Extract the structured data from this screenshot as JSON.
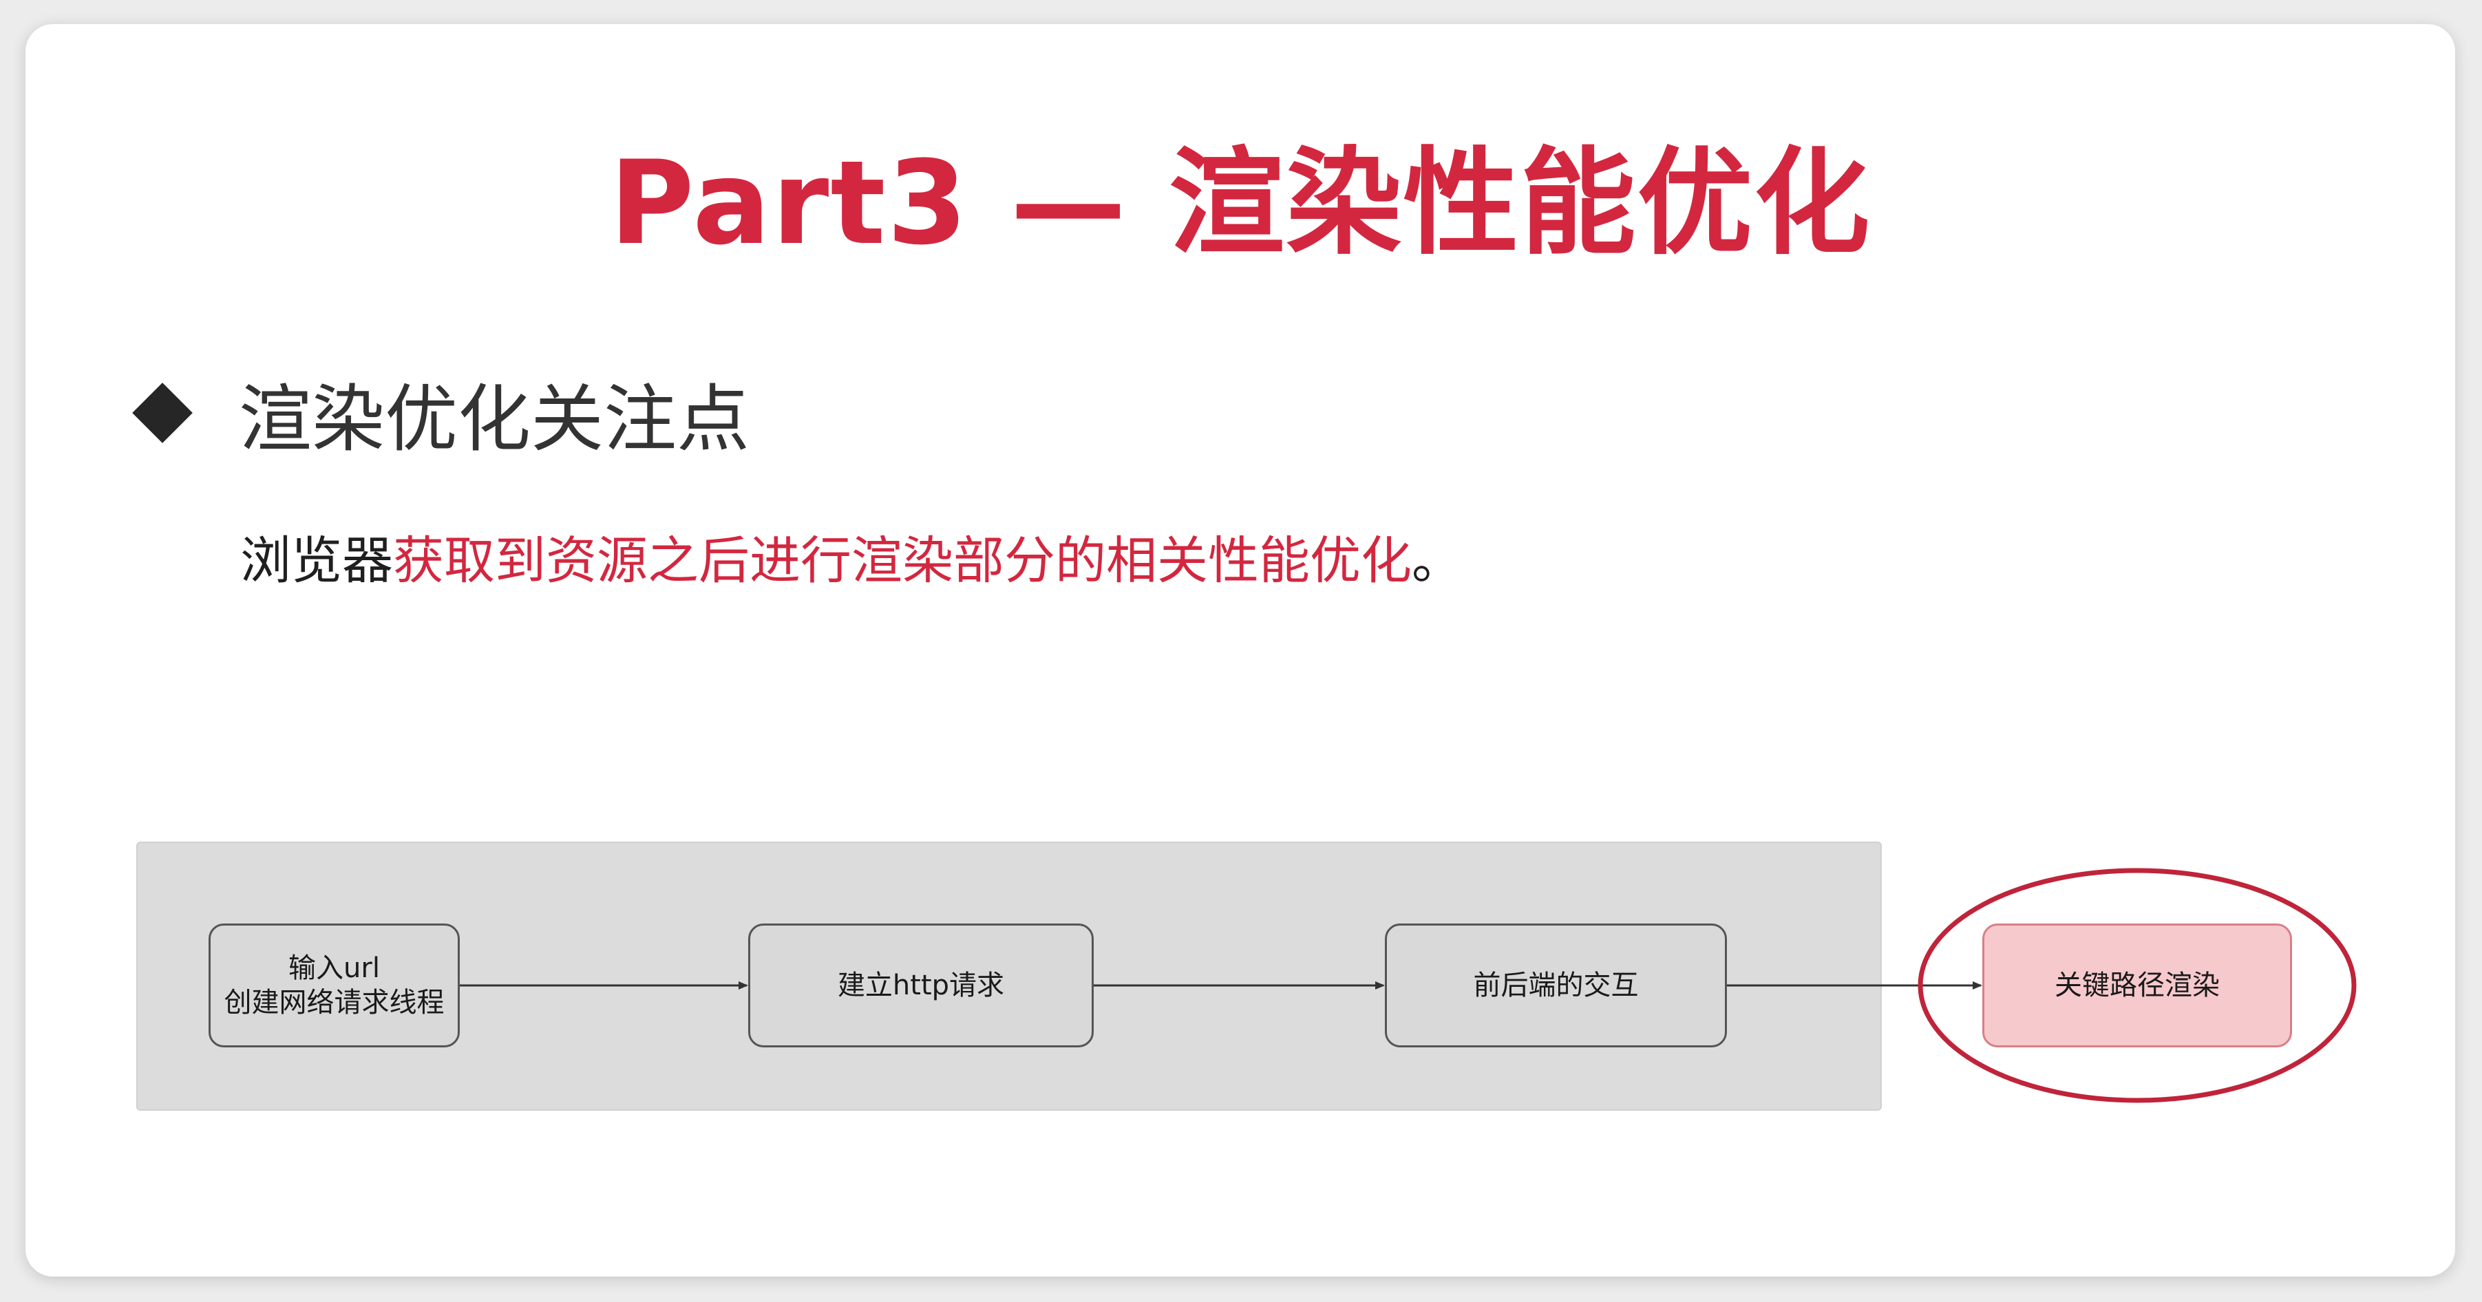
{
  "slide": {
    "title": "Part3 — 渲染性能优化",
    "heading": "渲染优化关注点",
    "description": {
      "prefix": "浏览器",
      "highlight": "获取到资源之后进行渲染部分的相关性能优化",
      "suffix": "。"
    }
  },
  "flow": {
    "nodes": [
      {
        "line1": "输入url",
        "line2": "创建网络请求线程"
      },
      {
        "label": "建立http请求"
      },
      {
        "label": "前后端的交互"
      },
      {
        "label": "关键路径渲染"
      }
    ]
  },
  "colors": {
    "accent": "#d3273f",
    "panel": "#dcdcdc",
    "node": "#d9d9d9",
    "highlight_node": "#f6c9cd"
  }
}
